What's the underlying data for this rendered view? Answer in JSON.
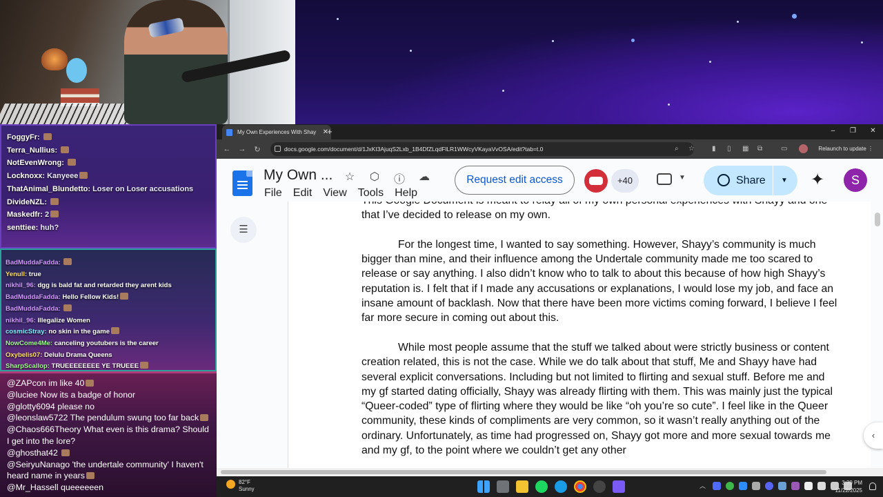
{
  "chat_top": [
    {
      "user": "FoggyFr:",
      "msg": ""
    },
    {
      "user": "Terra_Nullius:",
      "msg": ""
    },
    {
      "user": "NotEvenWrong:",
      "msg": ""
    },
    {
      "user": "Locknoxx:",
      "msg": "Kanyeee"
    },
    {
      "user": "ThatAnimal_Blundetto:",
      "msg": "Loser on Loser accusations"
    },
    {
      "user": "DivideNZL:",
      "msg": ""
    },
    {
      "user": "Maskedfr:",
      "msg": "2"
    },
    {
      "user": "senttiee:",
      "msg": "huh?"
    }
  ],
  "chat_mid": [
    {
      "user": "BadMuddaFadda:",
      "msg": ""
    },
    {
      "user": "Yenull:",
      "msg": "true"
    },
    {
      "user": "nikhil_96:",
      "msg": "dgg is bald fat and retarded they arent kids"
    },
    {
      "user": "BadMuddaFadda:",
      "msg": "Hello Fellow Kids!"
    },
    {
      "user": "BadMuddaFadda:",
      "msg": ""
    },
    {
      "user": "nikhil_96:",
      "msg": "Illegalize Women"
    },
    {
      "user": "cosmicStray:",
      "msg": "no skin in the game"
    },
    {
      "user": "NowCome4Me:",
      "msg": "canceling youtubers is the career"
    },
    {
      "user": "Oxybelis07:",
      "msg": "Delulu Drama Queens"
    },
    {
      "user": "SharpScallop:",
      "msg": "TRUEEEEEEEE YE TRUEEE"
    }
  ],
  "chat_bot": [
    {
      "user": "@ZAPcon",
      "msg": "im like 40"
    },
    {
      "user": "@luciee",
      "msg": "Now its a badge of honor"
    },
    {
      "user": "@glotty6094",
      "msg": "please no"
    },
    {
      "user": "@leonslaw5722",
      "msg": "The pendulum swung too far back"
    },
    {
      "user": "@Chaos666Theory",
      "msg": "What even is this drama? Should I get into the lore?"
    },
    {
      "user": "@ghosthat42",
      "msg": ""
    },
    {
      "user": "@SeiryuNanago",
      "msg": "'the undertale community' I haven't heard name in years"
    },
    {
      "user": "@Mr_Hassell",
      "msg": "queeeeeen"
    }
  ],
  "browser": {
    "tab_title": "My Own Experiences With Shay",
    "new_tab": "+",
    "minimize": "–",
    "maximize": "❐",
    "close": "✕",
    "url": "docs.google.com/document/d/1JxKI3AjuqS2Lxb_1B4DfZLqdFlLR1WWcyVKayaVvOSA/edit?tab=t.0",
    "relaunch_label": "Relaunch to update"
  },
  "docs": {
    "title": "My Own ...",
    "menus": [
      "File",
      "Edit",
      "View",
      "Tools",
      "Help"
    ],
    "request_edit": "Request edit access",
    "collaborators_count": "+40",
    "share_label": "Share",
    "avatar_letter": "S"
  },
  "document": {
    "paragraphs": [
      "This Google Document is meant to relay all of my own personal experiences with Shayy and one that I’ve decided to release on my own.",
      "For the longest time, I wanted to say something. However, Shayy’s community is much bigger than mine, and their influence among the Undertale community made me too scared to release or say anything. I also didn’t know who to talk to about this because of how high Shayy’s reputation is. I felt that if I made any accusations or explanations, I would lose my job, and face an insane amount of backlash. Now that there have been more victims coming forward, I believe I feel far more secure in coming out about this.",
      "While most people assume that the stuff we talked about were strictly business or content creation related, this is not the case. While we do talk about that stuff, Me and Shayy have had several explicit conversations. Including but not limited to flirting and sexual stuff. Before me and my gf started dating officially, Shayy was already flirting with them. This was mainly just the typical “Queer-coded” type of flirting where they would be like “oh you’re so cute”. I feel like in the Queer community, these kinds of compliments are very common, so it wasn’t really anything out of the ordinary. Unfortunately, as time had progressed on, Shayy got more and more sexual towards me and my gf, to the point where we couldn’t get any other"
    ]
  },
  "taskbar": {
    "temp": "82°F",
    "condition": "Sunny",
    "time": "3:39 PM",
    "date": "11/22/2025"
  },
  "colors": {
    "docs_blue": "#1a73e8",
    "share_bg": "#c2e7ff",
    "request_text": "#0b57d0",
    "avatar_bg": "#8e24aa"
  }
}
